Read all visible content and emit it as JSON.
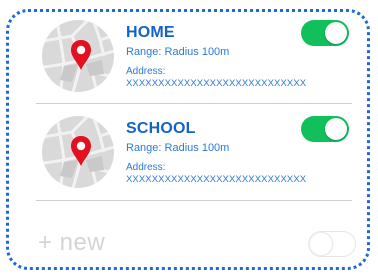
{
  "places": [
    {
      "name": "HOME",
      "range": "Range: Radius 100m",
      "address_label": "Address:",
      "address_value": "XXXXXXXXXXXXXXXXXXXXXXXXXXXX",
      "enabled": true,
      "icons": [
        "map-thumbnail-icon",
        "location-pin-icon"
      ]
    },
    {
      "name": "SCHOOL",
      "range": "Range: Radius 100m",
      "address_label": "Address:",
      "address_value": "XXXXXXXXXXXXXXXXXXXXXXXXXXXX",
      "enabled": true,
      "icons": [
        "map-thumbnail-icon",
        "location-pin-icon"
      ]
    }
  ],
  "new_place": {
    "label": "+ new",
    "enabled": false
  },
  "colors": {
    "accent": "#1463c8",
    "toggle_on": "#11c05a",
    "frame_border": "#1f6bd6",
    "pin": "#e3101f",
    "placeholder": "#d4d4d4"
  }
}
